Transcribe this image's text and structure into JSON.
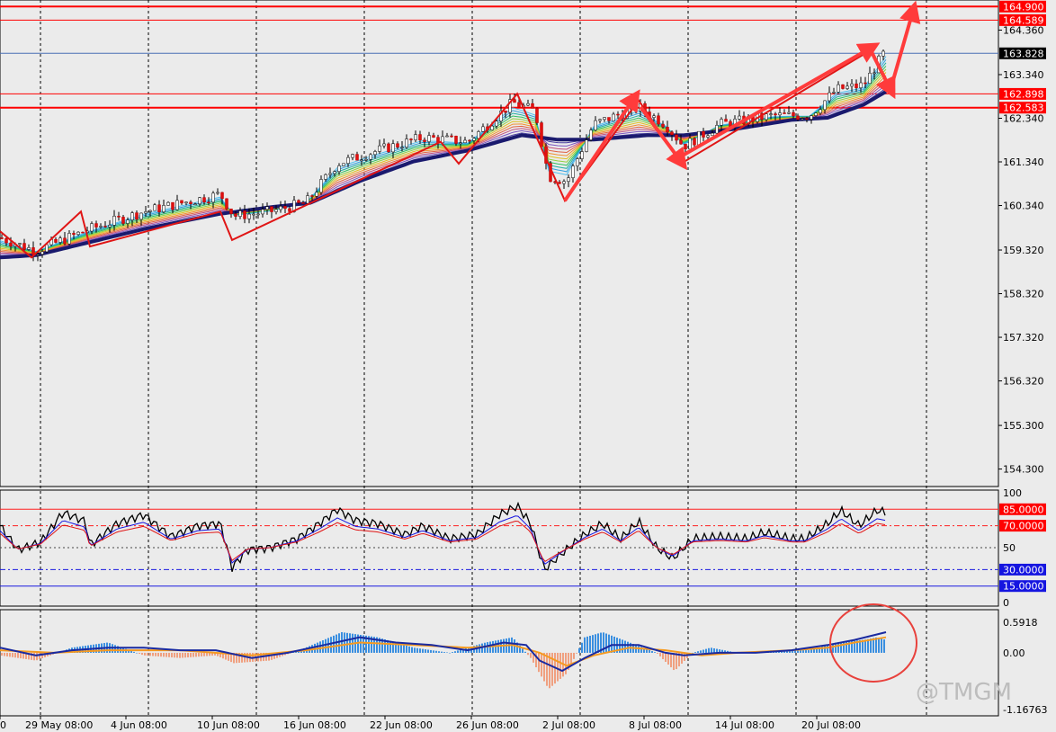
{
  "chart_data": {
    "type": "candlestick",
    "symbol_hint": "",
    "main_axis": {
      "ticks": [
        "164.360",
        "163.340",
        "162.340",
        "161.340",
        "160.340",
        "159.320",
        "158.320",
        "157.320",
        "156.320",
        "155.300",
        "154.300"
      ],
      "range": [
        153.9,
        165.05
      ]
    },
    "price_lines": [
      {
        "label": "164.900",
        "value": 164.9,
        "color": "#ff0000",
        "style": "thick"
      },
      {
        "label": "164.589",
        "value": 164.589,
        "color": "#ff0000",
        "style": "thin"
      },
      {
        "label": "163.828",
        "value": 163.828,
        "color": "#4a6fb5",
        "style": "current"
      },
      {
        "label": "162.898",
        "value": 162.898,
        "color": "#ff0000",
        "style": "thin"
      },
      {
        "label": "162.583",
        "value": 162.583,
        "color": "#ff0000",
        "style": "thick"
      }
    ],
    "time_labels": [
      "0",
      "29 May 08:00",
      "4 Jun 08:00",
      "10 Jun 08:00",
      "16 Jun 08:00",
      "22 Jun 08:00",
      "26 Jun 08:00",
      "2 Jul 08:00",
      "8 Jul 08:00",
      "14 Jul 08:00",
      "20 Jul 08:00"
    ],
    "zigzag": [
      [
        0,
        159.75
      ],
      [
        35,
        159.15
      ],
      [
        90,
        160.2
      ],
      [
        100,
        159.4
      ],
      [
        245,
        160.2
      ],
      [
        258,
        159.55
      ],
      [
        490,
        161.8
      ],
      [
        510,
        161.3
      ],
      [
        575,
        162.9
      ],
      [
        628,
        160.45
      ],
      [
        710,
        162.75
      ],
      [
        757,
        161.3
      ],
      [
        968,
        163.9
      ]
    ],
    "close_series": [
      [
        0,
        159.6
      ],
      [
        40,
        159.3
      ],
      [
        100,
        159.8
      ],
      [
        160,
        160.2
      ],
      [
        245,
        160.6
      ],
      [
        260,
        160.1
      ],
      [
        300,
        160.2
      ],
      [
        340,
        160.4
      ],
      [
        375,
        161.3
      ],
      [
        420,
        161.6
      ],
      [
        470,
        161.9
      ],
      [
        520,
        161.8
      ],
      [
        570,
        162.7
      ],
      [
        595,
        162.5
      ],
      [
        610,
        161.0
      ],
      [
        630,
        160.9
      ],
      [
        660,
        162.2
      ],
      [
        710,
        162.6
      ],
      [
        740,
        162.2
      ],
      [
        760,
        161.7
      ],
      [
        800,
        162.2
      ],
      [
        860,
        162.4
      ],
      [
        900,
        162.4
      ],
      [
        930,
        163.0
      ],
      [
        960,
        163.1
      ],
      [
        985,
        163.9
      ]
    ],
    "ema_slow": [
      [
        0,
        159.15
      ],
      [
        40,
        159.2
      ],
      [
        100,
        159.5
      ],
      [
        160,
        159.8
      ],
      [
        245,
        160.15
      ],
      [
        300,
        160.3
      ],
      [
        345,
        160.4
      ],
      [
        400,
        160.9
      ],
      [
        460,
        161.35
      ],
      [
        520,
        161.6
      ],
      [
        580,
        161.95
      ],
      [
        620,
        161.85
      ],
      [
        660,
        161.85
      ],
      [
        720,
        161.95
      ],
      [
        760,
        161.95
      ],
      [
        820,
        162.1
      ],
      [
        880,
        162.3
      ],
      [
        920,
        162.35
      ],
      [
        960,
        162.65
      ],
      [
        985,
        162.95
      ]
    ],
    "rsi": {
      "axis_ticks": [
        "100",
        "50",
        "0"
      ],
      "levels": [
        {
          "label": "85.0000",
          "value": 85,
          "color": "#ff2020"
        },
        {
          "label": "70.0000",
          "value": 70,
          "color": "#ff2020"
        },
        {
          "label": "30.0000",
          "value": 30,
          "color": "#1a1ae0"
        },
        {
          "label": "15.0000",
          "value": 15,
          "color": "#1a1ae0"
        }
      ],
      "series": [
        [
          0,
          70
        ],
        [
          20,
          48
        ],
        [
          45,
          55
        ],
        [
          70,
          82
        ],
        [
          95,
          74
        ],
        [
          100,
          52
        ],
        [
          130,
          72
        ],
        [
          160,
          80
        ],
        [
          190,
          60
        ],
        [
          220,
          70
        ],
        [
          245,
          72
        ],
        [
          258,
          32
        ],
        [
          275,
          48
        ],
        [
          300,
          50
        ],
        [
          330,
          58
        ],
        [
          355,
          72
        ],
        [
          375,
          85
        ],
        [
          395,
          75
        ],
        [
          420,
          72
        ],
        [
          450,
          62
        ],
        [
          470,
          70
        ],
        [
          500,
          58
        ],
        [
          530,
          62
        ],
        [
          555,
          80
        ],
        [
          575,
          88
        ],
        [
          590,
          72
        ],
        [
          605,
          30
        ],
        [
          625,
          45
        ],
        [
          650,
          62
        ],
        [
          670,
          72
        ],
        [
          690,
          58
        ],
        [
          710,
          74
        ],
        [
          730,
          50
        ],
        [
          748,
          40
        ],
        [
          770,
          58
        ],
        [
          800,
          60
        ],
        [
          830,
          58
        ],
        [
          850,
          64
        ],
        [
          880,
          58
        ],
        [
          895,
          58
        ],
        [
          920,
          72
        ],
        [
          935,
          84
        ],
        [
          955,
          70
        ],
        [
          975,
          84
        ],
        [
          985,
          82
        ]
      ]
    },
    "macd": {
      "axis_ticks": [
        "0.5918",
        "0.00",
        "-1.16763"
      ],
      "range": [
        -1.16763,
        0.8
      ],
      "hist": [
        [
          0,
          -0.05
        ],
        [
          40,
          -0.15
        ],
        [
          80,
          0.1
        ],
        [
          120,
          0.2
        ],
        [
          160,
          -0.05
        ],
        [
          200,
          -0.1
        ],
        [
          240,
          -0.05
        ],
        [
          260,
          -0.2
        ],
        [
          300,
          -0.15
        ],
        [
          340,
          0.1
        ],
        [
          380,
          0.4
        ],
        [
          420,
          0.3
        ],
        [
          460,
          0.1
        ],
        [
          500,
          0.0
        ],
        [
          540,
          0.2
        ],
        [
          570,
          0.3
        ],
        [
          590,
          -0.1
        ],
        [
          610,
          -0.7
        ],
        [
          630,
          -0.4
        ],
        [
          650,
          0.3
        ],
        [
          670,
          0.4
        ],
        [
          700,
          0.2
        ],
        [
          730,
          0.0
        ],
        [
          750,
          -0.35
        ],
        [
          770,
          0.0
        ],
        [
          790,
          0.1
        ],
        [
          820,
          0.0
        ],
        [
          860,
          0.05
        ],
        [
          900,
          0.05
        ],
        [
          930,
          0.2
        ],
        [
          960,
          0.25
        ],
        [
          975,
          0.3
        ],
        [
          985,
          0.25
        ]
      ],
      "line": [
        [
          0,
          0.1
        ],
        [
          40,
          -0.05
        ],
        [
          80,
          0.05
        ],
        [
          120,
          0.1
        ],
        [
          160,
          0.1
        ],
        [
          200,
          0.05
        ],
        [
          240,
          0.05
        ],
        [
          280,
          -0.1
        ],
        [
          320,
          0.0
        ],
        [
          360,
          0.15
        ],
        [
          400,
          0.3
        ],
        [
          440,
          0.2
        ],
        [
          480,
          0.15
        ],
        [
          520,
          0.05
        ],
        [
          560,
          0.2
        ],
        [
          585,
          0.15
        ],
        [
          600,
          -0.15
        ],
        [
          625,
          -0.35
        ],
        [
          650,
          -0.1
        ],
        [
          680,
          0.15
        ],
        [
          710,
          0.15
        ],
        [
          740,
          0.0
        ],
        [
          760,
          -0.05
        ],
        [
          800,
          0.0
        ],
        [
          840,
          0.0
        ],
        [
          880,
          0.05
        ],
        [
          920,
          0.15
        ],
        [
          950,
          0.25
        ],
        [
          985,
          0.4
        ]
      ],
      "signal": [
        [
          0,
          0.05
        ],
        [
          60,
          0.0
        ],
        [
          120,
          0.05
        ],
        [
          200,
          0.05
        ],
        [
          280,
          -0.05
        ],
        [
          340,
          0.05
        ],
        [
          400,
          0.2
        ],
        [
          460,
          0.15
        ],
        [
          520,
          0.1
        ],
        [
          570,
          0.15
        ],
        [
          600,
          0.0
        ],
        [
          630,
          -0.25
        ],
        [
          660,
          -0.05
        ],
        [
          700,
          0.1
        ],
        [
          740,
          0.05
        ],
        [
          780,
          -0.05
        ],
        [
          820,
          0.0
        ],
        [
          880,
          0.05
        ],
        [
          920,
          0.1
        ],
        [
          950,
          0.2
        ],
        [
          985,
          0.3
        ]
      ]
    }
  },
  "watermark": "@TMGM"
}
